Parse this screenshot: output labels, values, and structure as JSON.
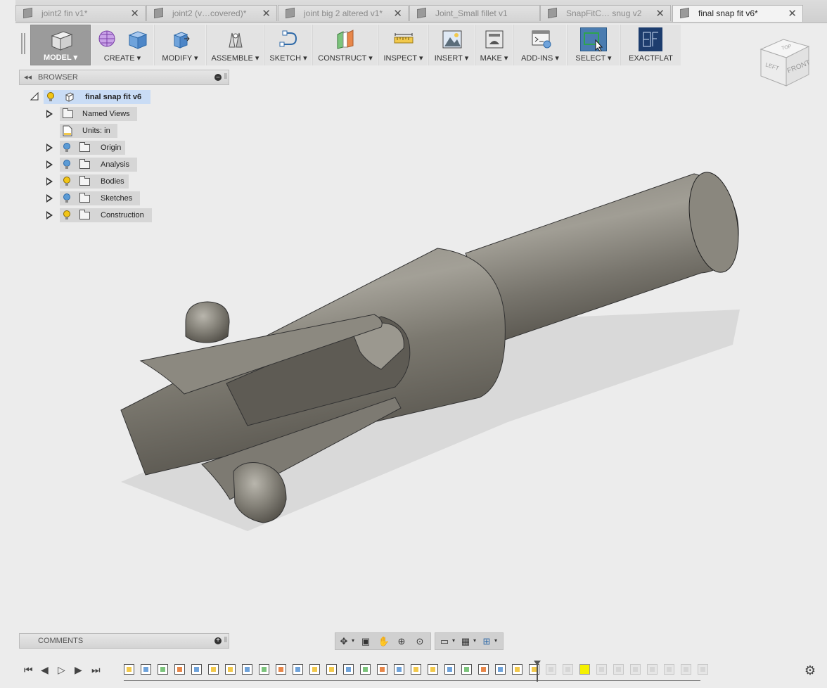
{
  "tabs": [
    {
      "label": "joint2 fin v1*",
      "active": false
    },
    {
      "label": "joint2 (v…covered)*",
      "active": false
    },
    {
      "label": "joint big 2 altered v1*",
      "active": false
    },
    {
      "label": "Joint_Small fillet v1",
      "active": false
    },
    {
      "label": "SnapFitC… snug v2",
      "active": false
    },
    {
      "label": "final snap fit v6*",
      "active": true
    }
  ],
  "toolbar": {
    "model": "MODEL ▾",
    "create": "CREATE ▾",
    "modify": "MODIFY ▾",
    "assemble": "ASSEMBLE ▾",
    "sketch": "SKETCH ▾",
    "construct": "CONSTRUCT ▾",
    "inspect": "INSPECT ▾",
    "insert": "INSERT ▾",
    "make": "MAKE ▾",
    "addins": "ADD-INS ▾",
    "select": "SELECT ▾",
    "exactflat": "EXACTFLAT"
  },
  "browser": {
    "title": "BROWSER",
    "root": "final snap fit v6",
    "items": [
      {
        "label": "Named Views",
        "bulb": false
      },
      {
        "label": "Units: in",
        "bulb": false
      },
      {
        "label": "Origin",
        "bulb": true,
        "bulb_color": "#5b9bd5"
      },
      {
        "label": "Analysis",
        "bulb": true,
        "bulb_color": "#5b9bd5"
      },
      {
        "label": "Bodies",
        "bulb": true,
        "bulb_color": "#f2c515"
      },
      {
        "label": "Sketches",
        "bulb": true,
        "bulb_color": "#5b9bd5"
      },
      {
        "label": "Construction",
        "bulb": true,
        "bulb_color": "#f2c515"
      }
    ]
  },
  "viewcube": {
    "top": "TOP",
    "left": "LEFT",
    "front": "FRONT"
  },
  "comments": {
    "title": "COMMENTS"
  },
  "colors": {
    "model_fill": "#7b786f",
    "highlight_yellow": "#f5f100",
    "select_blue": "#4a7cb0",
    "exactflat_navy": "#1d3d6e"
  }
}
